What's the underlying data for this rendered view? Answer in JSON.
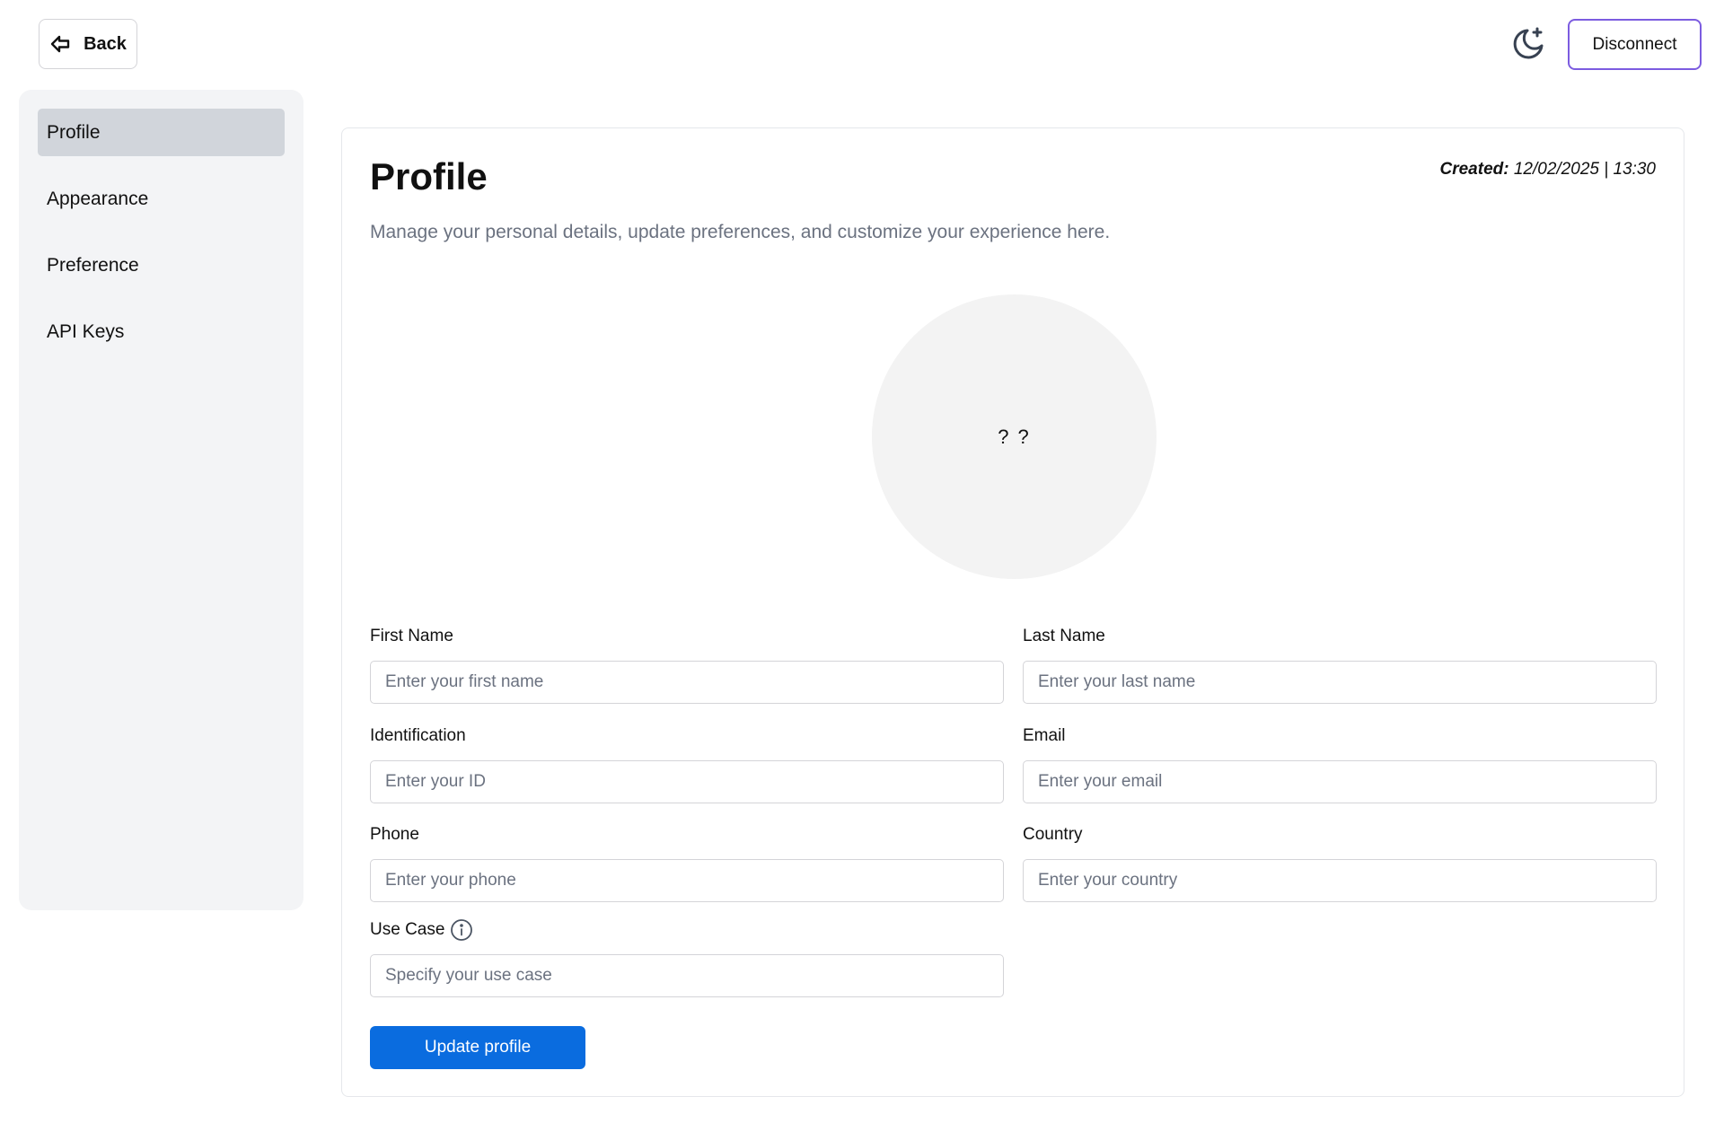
{
  "header": {
    "back_label": "Back",
    "disconnect_label": "Disconnect",
    "accent_color": "#7c5ce0"
  },
  "sidebar": {
    "items": [
      {
        "label": "Profile",
        "active": true
      },
      {
        "label": "Appearance",
        "active": false
      },
      {
        "label": "Preference",
        "active": false
      },
      {
        "label": "API Keys",
        "active": false
      }
    ]
  },
  "profile": {
    "title": "Profile",
    "created_label": "Created:",
    "created_value": "12/02/2025 | 13:30",
    "description": "Manage your personal details, update preferences, and customize your experience here.",
    "avatar_initials": "? ?",
    "fields": {
      "first_name": {
        "label": "First Name",
        "placeholder": "Enter your first name",
        "value": ""
      },
      "last_name": {
        "label": "Last Name",
        "placeholder": "Enter your last name",
        "value": ""
      },
      "identification": {
        "label": "Identification",
        "placeholder": "Enter your ID",
        "value": ""
      },
      "email": {
        "label": "Email",
        "placeholder": "Enter your email",
        "value": ""
      },
      "phone": {
        "label": "Phone",
        "placeholder": "Enter your phone",
        "value": ""
      },
      "country": {
        "label": "Country",
        "placeholder": "Enter your country",
        "value": ""
      },
      "use_case": {
        "label": "Use Case",
        "placeholder": "Specify your use case",
        "value": ""
      }
    },
    "update_label": "Update profile",
    "primary_color": "#0a6cdf"
  },
  "icons": {
    "back": "arrow-left-icon",
    "theme": "moon-star-icon",
    "info": "info-icon"
  }
}
